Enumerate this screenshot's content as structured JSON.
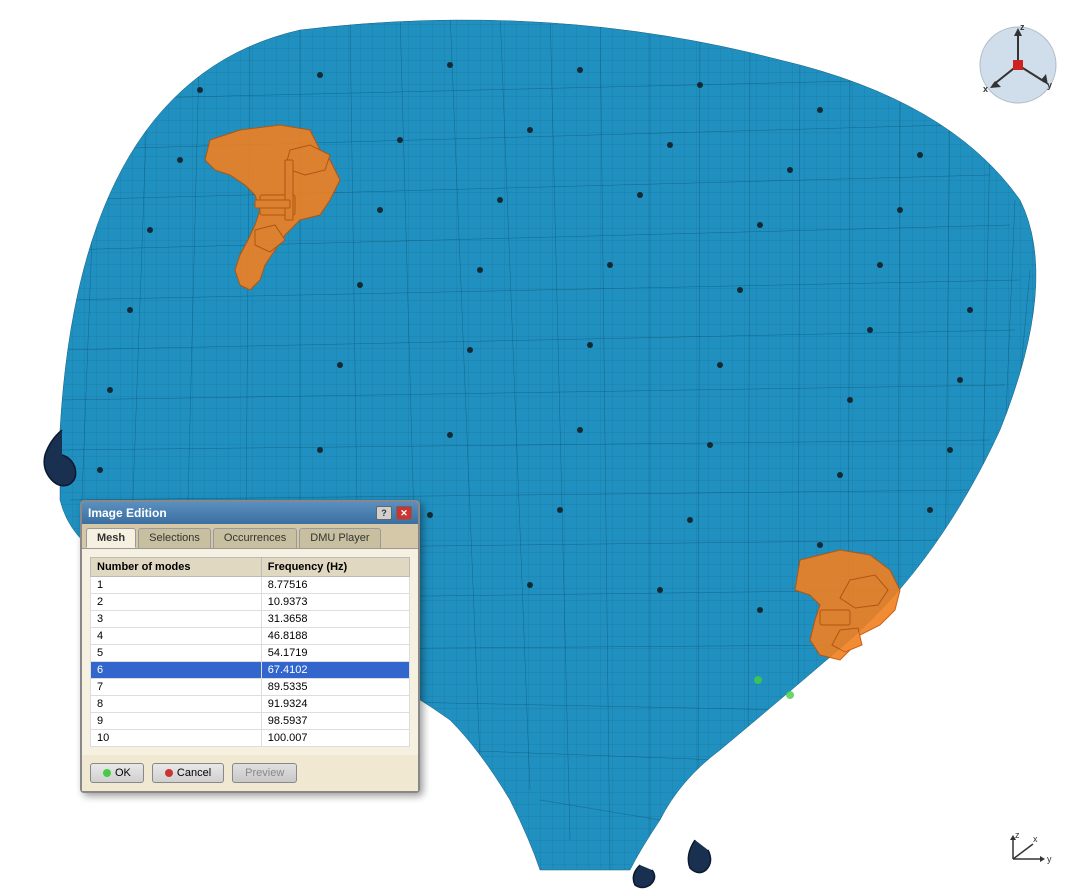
{
  "dialog": {
    "title": "Image Edition",
    "tabs": [
      "Mesh",
      "Selections",
      "Occurrences",
      "DMU Player"
    ],
    "active_tab": "Mesh",
    "table": {
      "headers": [
        "Number of modes",
        "Frequency (Hz)"
      ],
      "rows": [
        {
          "mode": "1",
          "frequency": "8.77516",
          "selected": false
        },
        {
          "mode": "2",
          "frequency": "10.9373",
          "selected": false
        },
        {
          "mode": "3",
          "frequency": "31.3658",
          "selected": false
        },
        {
          "mode": "4",
          "frequency": "46.8188",
          "selected": false
        },
        {
          "mode": "5",
          "frequency": "54.1719",
          "selected": false
        },
        {
          "mode": "6",
          "frequency": "67.4102",
          "selected": true
        },
        {
          "mode": "7",
          "frequency": "89.5335",
          "selected": false
        },
        {
          "mode": "8",
          "frequency": "91.9324",
          "selected": false
        },
        {
          "mode": "9",
          "frequency": "98.5937",
          "selected": false
        },
        {
          "mode": "10",
          "frequency": "100.007",
          "selected": false
        }
      ]
    },
    "buttons": {
      "ok": "OK",
      "cancel": "Cancel",
      "preview": "Preview"
    }
  },
  "axis": {
    "labels": {
      "x": "x",
      "y": "y",
      "z": "z"
    }
  }
}
